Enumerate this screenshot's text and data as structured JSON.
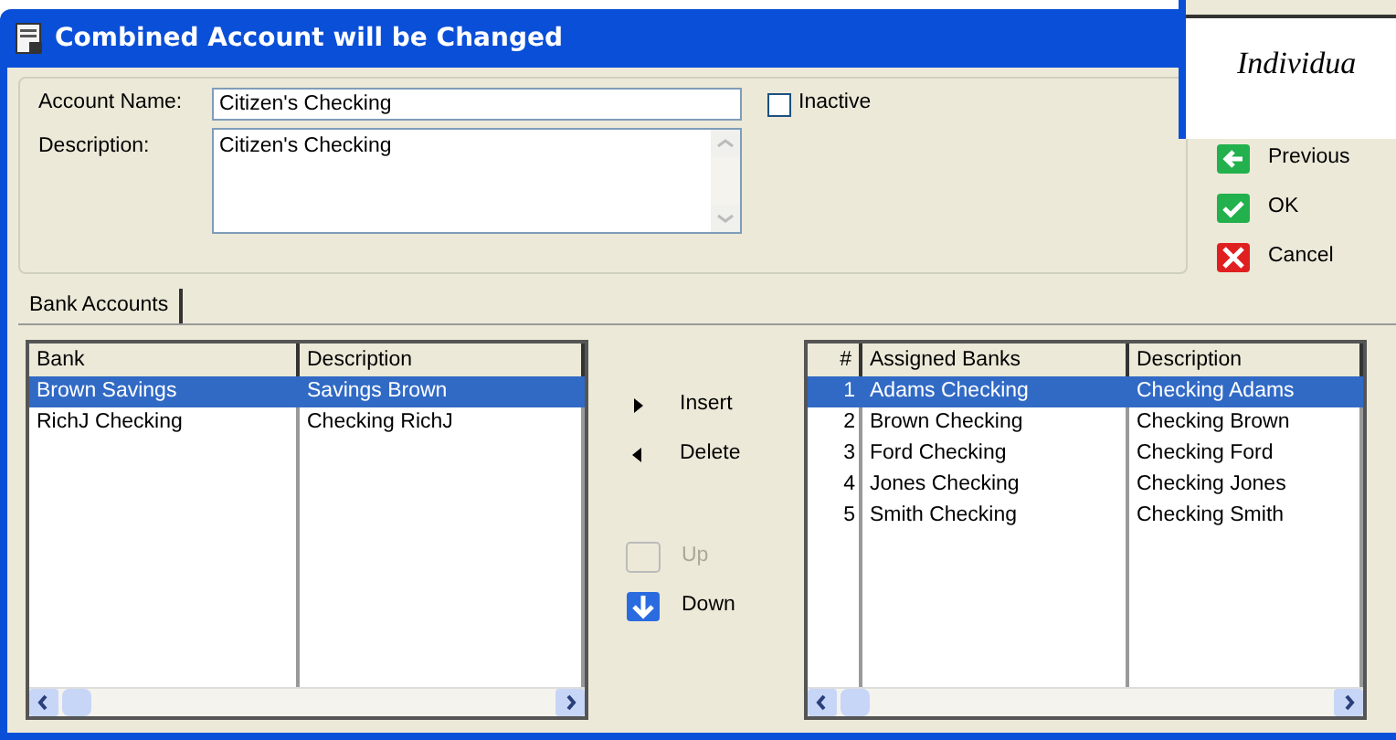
{
  "window": {
    "title": "Combined Account will be Changed"
  },
  "background_window": {
    "text": "Individua"
  },
  "account_name": {
    "label": "Account Name:",
    "value": "Citizen's Checking"
  },
  "inactive": {
    "label": "Inactive",
    "checked": false
  },
  "description": {
    "label": "Description:",
    "value": "Citizen's Checking"
  },
  "side_buttons": [
    {
      "kind": "previous",
      "label": "Previous"
    },
    {
      "kind": "ok",
      "label": "OK"
    },
    {
      "kind": "cancel",
      "label": "Cancel"
    }
  ],
  "tabs": [
    {
      "label": "Bank Accounts",
      "selected": true
    }
  ],
  "bank_list": {
    "columns": [
      "Bank",
      "Description"
    ],
    "rows": [
      {
        "cells": [
          "Brown Savings",
          "Savings Brown"
        ],
        "selected": true
      },
      {
        "cells": [
          "RichJ Checking",
          "Checking RichJ"
        ],
        "selected": false
      }
    ]
  },
  "move_buttons": [
    {
      "kind": "insert",
      "label": "Insert",
      "disabled": false
    },
    {
      "kind": "delete",
      "label": "Delete",
      "disabled": false
    },
    {
      "kind": "up",
      "label": "Up",
      "disabled": true
    },
    {
      "kind": "down",
      "label": "Down",
      "disabled": false
    }
  ],
  "assigned_list": {
    "columns": [
      "#",
      "Assigned Banks",
      "Description"
    ],
    "rows": [
      {
        "cells": [
          "1",
          "Adams Checking",
          "Checking Adams"
        ],
        "selected": true
      },
      {
        "cells": [
          "2",
          "Brown Checking",
          "Checking Brown"
        ],
        "selected": false
      },
      {
        "cells": [
          "3",
          "Ford Checking",
          "Checking Ford"
        ],
        "selected": false
      },
      {
        "cells": [
          "4",
          "Jones Checking",
          "Checking Jones"
        ],
        "selected": false
      },
      {
        "cells": [
          "5",
          "Smith Checking",
          "Checking Smith"
        ],
        "selected": false
      }
    ]
  }
}
